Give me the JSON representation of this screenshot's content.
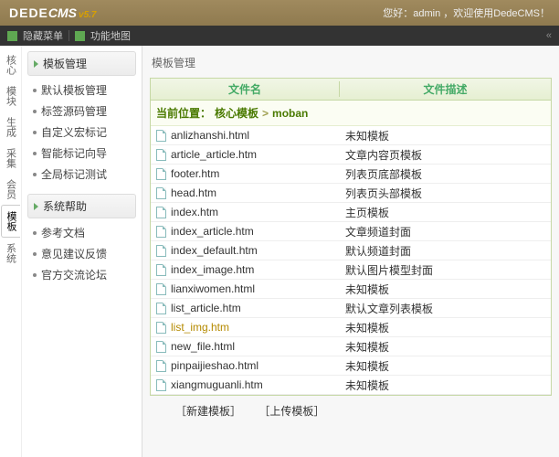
{
  "header": {
    "brand_dede": "DEDE",
    "brand_cms": "CMS",
    "version": "v5.7",
    "welcome": "您好：admin ，欢迎使用DedeCMS！"
  },
  "toolbar": {
    "hide_menu": "隐藏菜单",
    "site_map": "功能地图",
    "collapse": "«"
  },
  "vtabs": [
    "核心",
    "模块",
    "生成",
    "采集",
    "会员",
    "模板",
    "系统"
  ],
  "vtabs_active_index": 5,
  "sidebar": {
    "groups": [
      {
        "title": "模板管理",
        "items": [
          "默认模板管理",
          "标签源码管理",
          "自定义宏标记",
          "智能标记向导",
          "全局标记测试"
        ]
      },
      {
        "title": "系统帮助",
        "items": [
          "参考文档",
          "意见建议反馈",
          "官方交流论坛"
        ]
      }
    ]
  },
  "main": {
    "title": "模板管理",
    "columns": {
      "name": "文件名",
      "desc": "文件描述"
    },
    "breadcrumb": {
      "label": "当前位置：",
      "root": "核心模板",
      "sep": ">",
      "current": "moban"
    },
    "rows": [
      {
        "file": "anlizhanshi.html",
        "desc": "未知模板",
        "hl": false
      },
      {
        "file": "article_article.htm",
        "desc": "文章内容页模板",
        "hl": false
      },
      {
        "file": "footer.htm",
        "desc": "列表页底部模板",
        "hl": false
      },
      {
        "file": "head.htm",
        "desc": "列表页头部模板",
        "hl": false
      },
      {
        "file": "index.htm",
        "desc": "主页模板",
        "hl": false
      },
      {
        "file": "index_article.htm",
        "desc": "文章频道封面",
        "hl": false
      },
      {
        "file": "index_default.htm",
        "desc": "默认频道封面",
        "hl": false
      },
      {
        "file": "index_image.htm",
        "desc": "默认图片模型封面",
        "hl": false
      },
      {
        "file": "lianxiwomen.html",
        "desc": "未知模板",
        "hl": false
      },
      {
        "file": "list_article.htm",
        "desc": "默认文章列表模板",
        "hl": false
      },
      {
        "file": "list_img.htm",
        "desc": "未知模板",
        "hl": true
      },
      {
        "file": "new_file.html",
        "desc": "未知模板",
        "hl": false
      },
      {
        "file": "pinpaijieshao.html",
        "desc": "未知模板",
        "hl": false
      },
      {
        "file": "xiangmuguanli.htm",
        "desc": "未知模板",
        "hl": false
      }
    ],
    "actions": {
      "new": "［新建模板］",
      "upload": "［上传模板］"
    }
  }
}
